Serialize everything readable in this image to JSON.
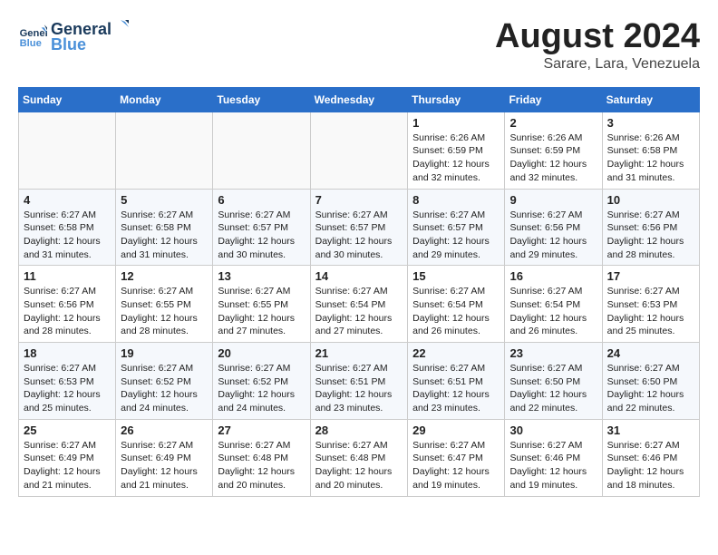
{
  "logo": {
    "line1": "General",
    "line2": "Blue"
  },
  "title": "August 2024",
  "subtitle": "Sarare, Lara, Venezuela",
  "headers": [
    "Sunday",
    "Monday",
    "Tuesday",
    "Wednesday",
    "Thursday",
    "Friday",
    "Saturday"
  ],
  "weeks": [
    [
      {
        "day": "",
        "info": ""
      },
      {
        "day": "",
        "info": ""
      },
      {
        "day": "",
        "info": ""
      },
      {
        "day": "",
        "info": ""
      },
      {
        "day": "1",
        "info": "Sunrise: 6:26 AM\nSunset: 6:59 PM\nDaylight: 12 hours and 32 minutes."
      },
      {
        "day": "2",
        "info": "Sunrise: 6:26 AM\nSunset: 6:59 PM\nDaylight: 12 hours and 32 minutes."
      },
      {
        "day": "3",
        "info": "Sunrise: 6:26 AM\nSunset: 6:58 PM\nDaylight: 12 hours and 31 minutes."
      }
    ],
    [
      {
        "day": "4",
        "info": "Sunrise: 6:27 AM\nSunset: 6:58 PM\nDaylight: 12 hours and 31 minutes."
      },
      {
        "day": "5",
        "info": "Sunrise: 6:27 AM\nSunset: 6:58 PM\nDaylight: 12 hours and 31 minutes."
      },
      {
        "day": "6",
        "info": "Sunrise: 6:27 AM\nSunset: 6:57 PM\nDaylight: 12 hours and 30 minutes."
      },
      {
        "day": "7",
        "info": "Sunrise: 6:27 AM\nSunset: 6:57 PM\nDaylight: 12 hours and 30 minutes."
      },
      {
        "day": "8",
        "info": "Sunrise: 6:27 AM\nSunset: 6:57 PM\nDaylight: 12 hours and 29 minutes."
      },
      {
        "day": "9",
        "info": "Sunrise: 6:27 AM\nSunset: 6:56 PM\nDaylight: 12 hours and 29 minutes."
      },
      {
        "day": "10",
        "info": "Sunrise: 6:27 AM\nSunset: 6:56 PM\nDaylight: 12 hours and 28 minutes."
      }
    ],
    [
      {
        "day": "11",
        "info": "Sunrise: 6:27 AM\nSunset: 6:56 PM\nDaylight: 12 hours and 28 minutes."
      },
      {
        "day": "12",
        "info": "Sunrise: 6:27 AM\nSunset: 6:55 PM\nDaylight: 12 hours and 28 minutes."
      },
      {
        "day": "13",
        "info": "Sunrise: 6:27 AM\nSunset: 6:55 PM\nDaylight: 12 hours and 27 minutes."
      },
      {
        "day": "14",
        "info": "Sunrise: 6:27 AM\nSunset: 6:54 PM\nDaylight: 12 hours and 27 minutes."
      },
      {
        "day": "15",
        "info": "Sunrise: 6:27 AM\nSunset: 6:54 PM\nDaylight: 12 hours and 26 minutes."
      },
      {
        "day": "16",
        "info": "Sunrise: 6:27 AM\nSunset: 6:54 PM\nDaylight: 12 hours and 26 minutes."
      },
      {
        "day": "17",
        "info": "Sunrise: 6:27 AM\nSunset: 6:53 PM\nDaylight: 12 hours and 25 minutes."
      }
    ],
    [
      {
        "day": "18",
        "info": "Sunrise: 6:27 AM\nSunset: 6:53 PM\nDaylight: 12 hours and 25 minutes."
      },
      {
        "day": "19",
        "info": "Sunrise: 6:27 AM\nSunset: 6:52 PM\nDaylight: 12 hours and 24 minutes."
      },
      {
        "day": "20",
        "info": "Sunrise: 6:27 AM\nSunset: 6:52 PM\nDaylight: 12 hours and 24 minutes."
      },
      {
        "day": "21",
        "info": "Sunrise: 6:27 AM\nSunset: 6:51 PM\nDaylight: 12 hours and 23 minutes."
      },
      {
        "day": "22",
        "info": "Sunrise: 6:27 AM\nSunset: 6:51 PM\nDaylight: 12 hours and 23 minutes."
      },
      {
        "day": "23",
        "info": "Sunrise: 6:27 AM\nSunset: 6:50 PM\nDaylight: 12 hours and 22 minutes."
      },
      {
        "day": "24",
        "info": "Sunrise: 6:27 AM\nSunset: 6:50 PM\nDaylight: 12 hours and 22 minutes."
      }
    ],
    [
      {
        "day": "25",
        "info": "Sunrise: 6:27 AM\nSunset: 6:49 PM\nDaylight: 12 hours and 21 minutes."
      },
      {
        "day": "26",
        "info": "Sunrise: 6:27 AM\nSunset: 6:49 PM\nDaylight: 12 hours and 21 minutes."
      },
      {
        "day": "27",
        "info": "Sunrise: 6:27 AM\nSunset: 6:48 PM\nDaylight: 12 hours and 20 minutes."
      },
      {
        "day": "28",
        "info": "Sunrise: 6:27 AM\nSunset: 6:48 PM\nDaylight: 12 hours and 20 minutes."
      },
      {
        "day": "29",
        "info": "Sunrise: 6:27 AM\nSunset: 6:47 PM\nDaylight: 12 hours and 19 minutes."
      },
      {
        "day": "30",
        "info": "Sunrise: 6:27 AM\nSunset: 6:46 PM\nDaylight: 12 hours and 19 minutes."
      },
      {
        "day": "31",
        "info": "Sunrise: 6:27 AM\nSunset: 6:46 PM\nDaylight: 12 hours and 18 minutes."
      }
    ]
  ]
}
